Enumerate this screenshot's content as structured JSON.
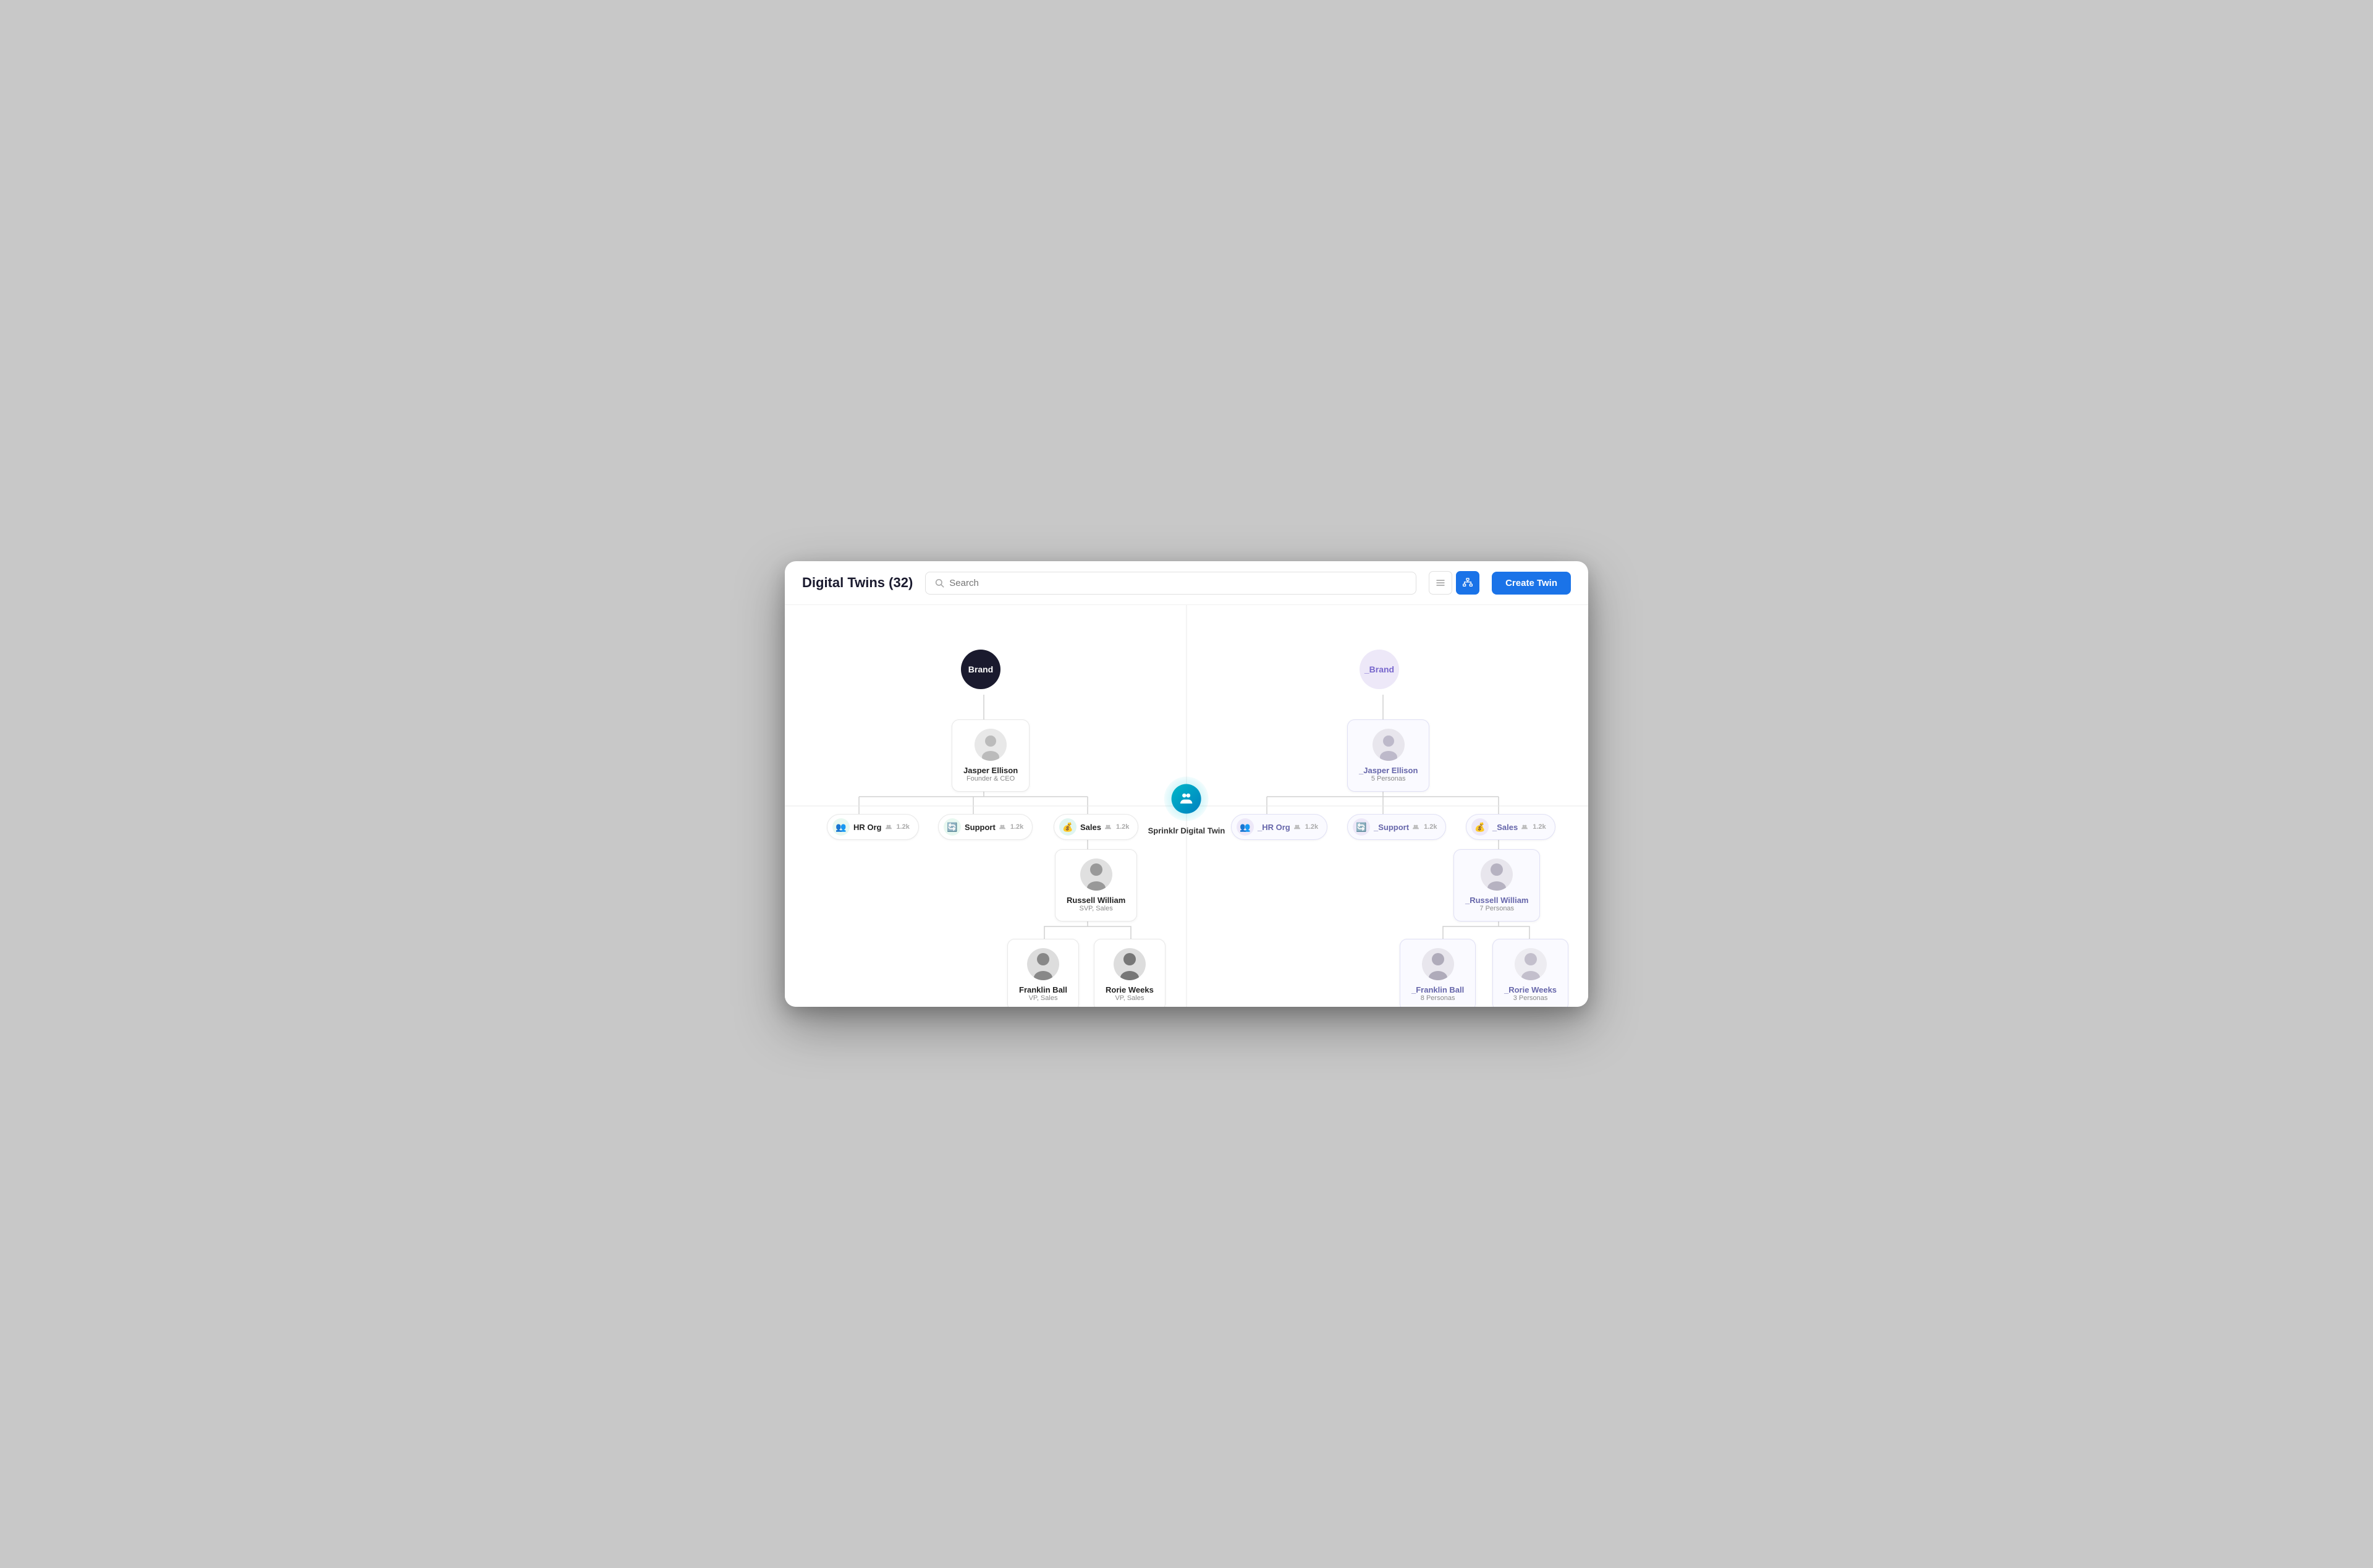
{
  "header": {
    "title": "Digital Twins (32)",
    "search_placeholder": "Search",
    "create_button": "Create Twin",
    "view_list_label": "List View",
    "view_tree_label": "Tree View"
  },
  "center_node": {
    "label": "Sprinklr Digital Twin"
  },
  "left_tree": {
    "brand": {
      "label": "Brand"
    },
    "root_person": {
      "name": "Jasper Ellison",
      "title": "Founder & CEO"
    },
    "orgs": [
      {
        "label": "HR Org",
        "count": "1.2k",
        "color": "#2ecc8a",
        "icon": "👥"
      },
      {
        "label": "Support",
        "count": "1.2k",
        "color": "#2ecc8a",
        "icon": "🔄"
      },
      {
        "label": "Sales",
        "count": "1.2k",
        "color": "#1a9e8a",
        "icon": "💰"
      }
    ],
    "sales_person": {
      "name": "Russell William",
      "title": "SVP, Sales"
    },
    "vp_persons": [
      {
        "name": "Franklin Ball",
        "title": "VP, Sales"
      },
      {
        "name": "Rorie Weeks",
        "title": "VP, Sales"
      }
    ]
  },
  "right_tree": {
    "brand": {
      "label": "_Brand"
    },
    "root_person": {
      "name": "_Jasper Ellison",
      "personas": "5 Personas"
    },
    "orgs": [
      {
        "label": "_HR Org",
        "count": "1.2k"
      },
      {
        "label": "_Support",
        "count": "1.2k"
      },
      {
        "label": "_Sales",
        "count": "1.2k"
      }
    ],
    "sales_person": {
      "name": "_Russell William",
      "personas": "7 Personas"
    },
    "vp_persons": [
      {
        "name": "_Franklin Ball",
        "personas": "8 Personas"
      },
      {
        "name": "_Rorie Weeks",
        "personas": "3 Personas"
      }
    ]
  }
}
